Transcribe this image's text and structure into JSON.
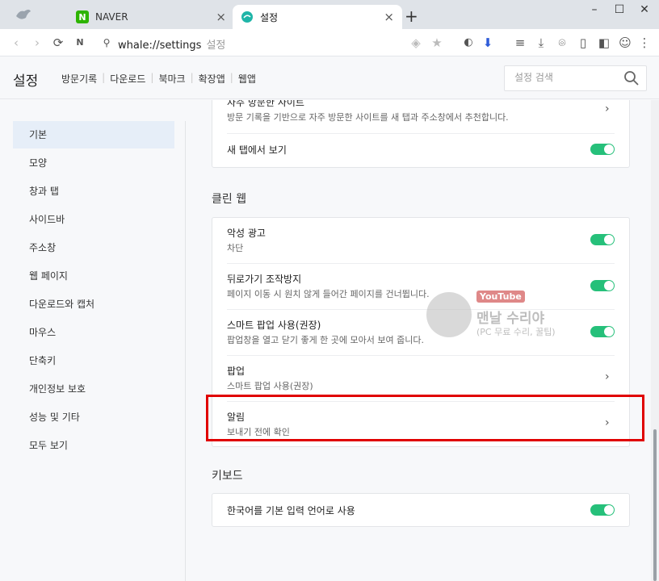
{
  "tabs": [
    {
      "label": "NAVER",
      "favicon": "N"
    },
    {
      "label": "설정"
    }
  ],
  "address": {
    "url": "whale://settings",
    "hint": "설정"
  },
  "header": {
    "title": "설정",
    "links": [
      "방문기록",
      "다운로드",
      "북마크",
      "확장앱",
      "웹앱"
    ],
    "search_placeholder": "설정 검색"
  },
  "sidebar": {
    "items": [
      "기본",
      "모양",
      "창과 탭",
      "사이드바",
      "주소창",
      "웹 페이지",
      "다운로드와 캡처",
      "마우스",
      "단축키",
      "개인정보 보호",
      "성능 및 기타",
      "모두 보기"
    ],
    "active": "기본"
  },
  "content": {
    "top_card": {
      "frequent_title": "자주 방문한 사이트",
      "frequent_desc": "방문 기록을 기반으로 자주 방문한 사이트를 새 탭과 주소창에서 추천합니다.",
      "newtab_label": "새 탭에서 보기",
      "newtab_on": true
    },
    "clean_web": {
      "title": "클린 웹",
      "rows": [
        {
          "title": "악성 광고",
          "desc": "차단",
          "type": "toggle",
          "on": true
        },
        {
          "title": "뒤로가기 조작방지",
          "desc": "페이지 이동 시 원치 않게 들어간 페이지를 건너뜁니다.",
          "type": "toggle",
          "on": true
        },
        {
          "title": "스마트 팝업 사용(권장)",
          "desc": "팝업창을 열고 닫기 좋게 한 곳에 모아서 보여 줍니다.",
          "type": "toggle",
          "on": true
        },
        {
          "title": "팝업",
          "desc": "스마트 팝업 사용(권장)",
          "type": "link"
        },
        {
          "title": "알림",
          "desc": "보내기 전에 확인",
          "type": "link"
        }
      ]
    },
    "keyboard": {
      "title": "키보드",
      "row": {
        "title": "한국어를 기본 입력 언어로 사용",
        "on": true
      }
    }
  },
  "watermark": {
    "badge": "YouTube",
    "name": "맨날 수리야",
    "sub": "(PC 무료 수리, 꿀팁)"
  },
  "colors": {
    "toggle_on": "#26c07a",
    "highlight": "#e00000",
    "active_sidebar": "#e6eef8"
  }
}
